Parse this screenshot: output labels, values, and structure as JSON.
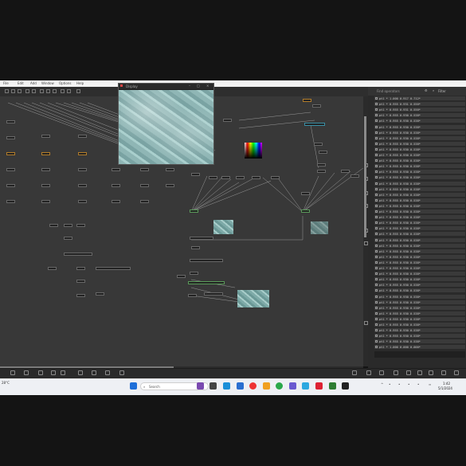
{
  "app": {
    "menu": [
      "File",
      "Edit",
      "Add",
      "Window",
      "Options",
      "Help"
    ],
    "preview_title": "Display",
    "right_panel_title": "Find operators",
    "right_panel_filter": "Filter"
  },
  "colors": {
    "background": "#141414",
    "canvas": "#383838",
    "panel": "#2a2a2a",
    "taskbar": "#eef0f4",
    "accent_cyan": "#3a8fa5",
    "accent_orange": "#b07b2a"
  },
  "right_list": {
    "rows": [
      "pt1 * 1.000 0.917 0.712*",
      "pt1 * 0.955 0.931 0.550*",
      "pt1 * 0.955 0.931 0.550*",
      "pt1 * 0.955 0.930 0.538*",
      "pt1 * 0.955 0.930 0.538*",
      "pt1 * 0.955 0.930 0.538*",
      "pt1 * 0.955 0.930 0.538*",
      "pt1 * 0.955 0.930 0.538*",
      "pt1 * 0.955 0.930 0.538*",
      "pt1 * 0.955 0.930 0.538*",
      "pt1 * 0.955 0.930 0.538*",
      "pt1 * 0.955 0.930 0.538*",
      "pt1 * 0.955 0.930 0.538*",
      "pt1 * 0.955 0.930 0.538*",
      "pt1 * 0.955 0.930 0.538*",
      "pt1 * 0.955 0.930 0.538*",
      "pt1 * 0.955 0.930 0.538*",
      "pt1 * 0.955 0.930 0.538*",
      "pt1 * 0.955 0.930 0.538*",
      "pt1 * 0.955 0.930 0.538*",
      "pt1 * 0.955 0.930 0.538*",
      "pt1 * 0.955 0.930 0.538*",
      "pt1 * 0.955 0.930 0.538*",
      "pt1 * 0.955 0.930 0.538*",
      "pt1 * 0.955 0.930 0.538*",
      "pt1 * 0.955 0.930 0.538*",
      "pt1 * 0.955 0.930 0.538*",
      "pt1 * 0.955 0.930 0.538*",
      "pt1 * 0.955 0.930 0.538*",
      "pt1 * 0.955 0.930 0.538*",
      "pt1 * 0.955 0.930 0.538*",
      "pt1 * 0.955 0.930 0.538*",
      "pt1 * 0.955 0.930 0.538*",
      "pt1 * 0.955 0.930 0.538*",
      "pt1 * 0.955 0.930 0.538*",
      "pt1 * 0.955 0.930 0.538*",
      "pt1 * 0.955 0.930 0.538*",
      "pt1 * 0.955 0.930 0.538*",
      "pt1 * 0.955 0.930 0.538*",
      "pt1 * 0.955 0.930 0.538*",
      "pt1 * 0.955 0.930 0.538*",
      "pt1 * 0.955 0.930 0.538*",
      "pt1 * 0.955 0.930 0.538*",
      "pt1 * 0.955 0.930 0.538*",
      "pt1 * 1.000 0.000 0.000*"
    ]
  },
  "taskbar": {
    "search_placeholder": "Search",
    "weather": "28°C",
    "time": "1:42",
    "date": "5/1/2024"
  }
}
